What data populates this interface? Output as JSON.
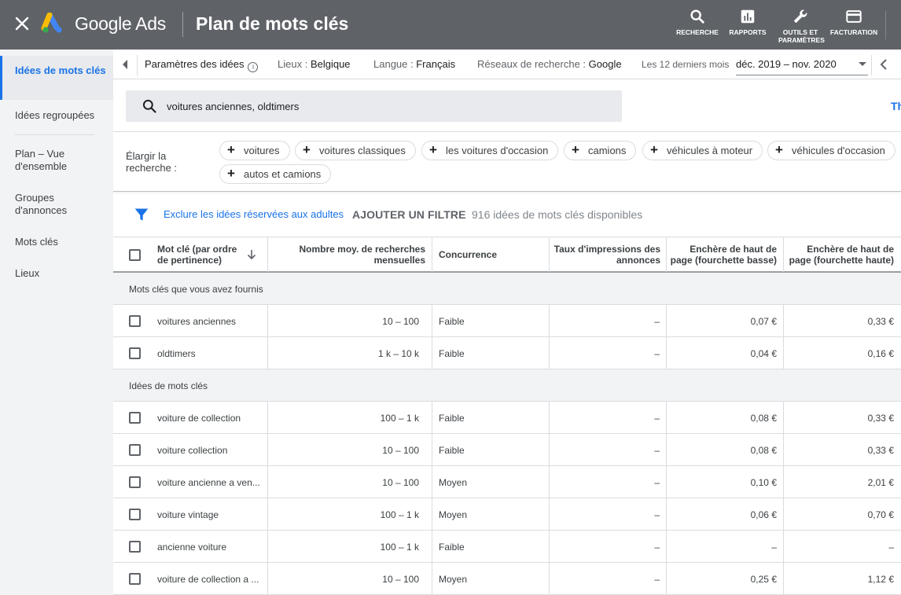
{
  "topbar": {
    "brand": "Google Ads",
    "title": "Plan de mots clés",
    "tools": [
      {
        "label": "RECHERCHE",
        "icon": "search-icon"
      },
      {
        "label": "RAPPORTS",
        "icon": "reports-icon"
      },
      {
        "label": "OUTILS ET PARAMÈTRES",
        "icon": "wrench-icon"
      },
      {
        "label": "FACTURATION",
        "icon": "billing-icon"
      }
    ]
  },
  "sidebar": {
    "items": [
      {
        "label": "Idées de mots clés",
        "active": true
      },
      {
        "label": "Idées regroupées"
      },
      {
        "label": "Plan – Vue d'ensemble"
      },
      {
        "label": "Groupes d'annonces"
      },
      {
        "label": "Mots clés"
      },
      {
        "label": "Lieux"
      }
    ]
  },
  "params": {
    "title": "Paramètres des idées",
    "location_key": "Lieux :",
    "location_value": "Belgique",
    "language_key": "Langue :",
    "language_value": "Français",
    "network_key": "Réseaux de recherche :",
    "network_value": "Google",
    "period_label": "Les 12 derniers mois",
    "period_value": "déc. 2019 – nov. 2020"
  },
  "search": {
    "query": "voitures anciennes, oldtimers",
    "edge_text": "Th"
  },
  "broaden": {
    "label": "Élargir la recherche :",
    "chips": [
      "voitures",
      "voitures classiques",
      "les voitures d'occasion",
      "camions",
      "véhicules à moteur",
      "véhicules d'occasion",
      "autos et camions"
    ]
  },
  "filters": {
    "exclude_adult": "Exclure les idées réservées aux adultes",
    "add_filter": "AJOUTER UN FILTRE",
    "available": "916 idées de mots clés disponibles"
  },
  "table": {
    "columns": [
      "Mot clé (par ordre de pertinence)",
      "Nombre moy. de recherches mensuelles",
      "Concurrence",
      "Taux d'impressions des annonces",
      "Enchère de haut de page (fourchette basse)",
      "Enchère de haut de page (fourchette haute)"
    ],
    "sections": [
      {
        "title": "Mots clés que vous avez fournis",
        "rows": [
          {
            "keyword": "voitures anciennes",
            "searches": "10 – 100",
            "competition": "Faible",
            "impr": "–",
            "bid_low": "0,07 €",
            "bid_high": "0,33 €"
          },
          {
            "keyword": "oldtimers",
            "searches": "1 k – 10 k",
            "competition": "Faible",
            "impr": "–",
            "bid_low": "0,04 €",
            "bid_high": "0,16 €"
          }
        ]
      },
      {
        "title": "Idées de mots clés",
        "rows": [
          {
            "keyword": "voiture de collection",
            "searches": "100 – 1 k",
            "competition": "Faible",
            "impr": "–",
            "bid_low": "0,08 €",
            "bid_high": "0,33 €"
          },
          {
            "keyword": "voiture collection",
            "searches": "10 – 100",
            "competition": "Faible",
            "impr": "–",
            "bid_low": "0,08 €",
            "bid_high": "0,33 €"
          },
          {
            "keyword": "voiture ancienne a ven...",
            "searches": "10 – 100",
            "competition": "Moyen",
            "impr": "–",
            "bid_low": "0,10 €",
            "bid_high": "2,01 €"
          },
          {
            "keyword": "voiture vintage",
            "searches": "100 – 1 k",
            "competition": "Moyen",
            "impr": "–",
            "bid_low": "0,06 €",
            "bid_high": "0,70 €"
          },
          {
            "keyword": "ancienne voiture",
            "searches": "100 – 1 k",
            "competition": "Faible",
            "impr": "–",
            "bid_low": "–",
            "bid_high": "–"
          },
          {
            "keyword": "voiture de collection a ...",
            "searches": "10 – 100",
            "competition": "Moyen",
            "impr": "–",
            "bid_low": "0,25 €",
            "bid_high": "1,12 €"
          }
        ]
      }
    ]
  },
  "colors": {
    "topbar": "#5f6368",
    "accent": "#1a73e8",
    "sidebar": "#f1f3f4"
  }
}
